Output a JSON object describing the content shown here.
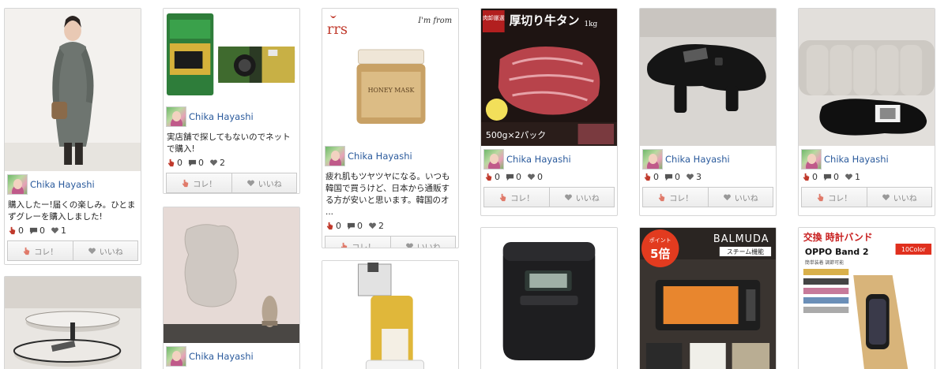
{
  "colors": {
    "username": "#2a5a9c",
    "hand": "#c0392b",
    "button_bg": "#ececec"
  },
  "icons": {
    "like": "hand-pointer-icon",
    "comment": "comment-bubble-icon",
    "heart": "heart-icon"
  },
  "buttons": {
    "kore": "コレ！",
    "iine": "いいね"
  },
  "cards": [
    {
      "user": "Chika Hayashi",
      "desc": "購入したー!届くの楽しみ。ひとまずグレーを購入しました!",
      "likes": "0",
      "comments": "0",
      "hearts": "1"
    },
    {
      "user": "",
      "desc": "",
      "likes": "",
      "comments": "",
      "hearts": ""
    },
    {
      "user": "Chika Hayashi",
      "desc": "実店舗で探してもないのでネットで購入!",
      "likes": "0",
      "comments": "0",
      "hearts": "2"
    },
    {
      "user": "Chika Hayashi",
      "desc": "",
      "likes": "",
      "comments": "",
      "hearts": ""
    },
    {
      "user": "Chika Hayashi",
      "desc": "疲れ肌もツヤツヤになる。いつも韓国で買うけど、日本から通販する方が安いと思います。韓国のオ ...",
      "likes": "0",
      "comments": "0",
      "hearts": "2",
      "img_brand": "I'm from",
      "img_product": "HONEY MASK"
    },
    {
      "user": "",
      "desc": "",
      "likes": "",
      "comments": "",
      "hearts": ""
    },
    {
      "user": "Chika Hayashi",
      "desc": "",
      "likes": "0",
      "comments": "0",
      "hearts": "0",
      "img_title": "厚切り牛タン",
      "img_weight": "1kg",
      "img_badge": "肉卸厳選",
      "img_sub": "500g×2パック"
    },
    {
      "user": "",
      "desc": "",
      "likes": "",
      "comments": "",
      "hearts": ""
    },
    {
      "user": "Chika Hayashi",
      "desc": "",
      "likes": "0",
      "comments": "0",
      "hearts": "3"
    },
    {
      "user": "",
      "desc": "",
      "likes": "",
      "comments": "",
      "hearts": "",
      "img_brand": "BALMUDA",
      "img_badge_top": "ポイント",
      "img_badge_num": "5倍",
      "img_sub": "スチーム機能"
    },
    {
      "user": "Chika Hayashi",
      "desc": "",
      "likes": "0",
      "comments": "0",
      "hearts": "1"
    },
    {
      "user": "",
      "desc": "",
      "likes": "",
      "comments": "",
      "hearts": "",
      "img_title": "交換 時計バンド",
      "img_product": "OPPO Band 2",
      "img_color": "10Color",
      "img_sub": "簡単装着 調節可能"
    }
  ]
}
